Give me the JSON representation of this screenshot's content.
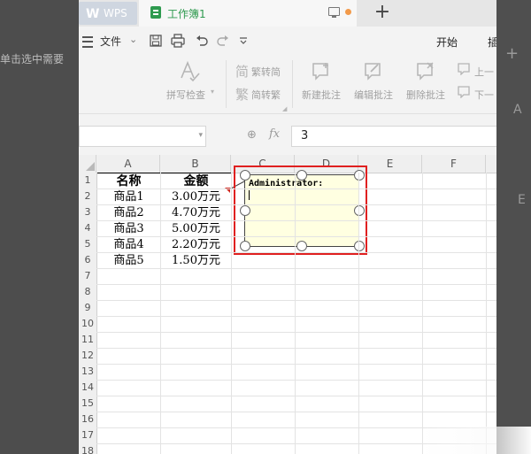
{
  "background": {
    "left_fragment": "单击选中需要",
    "right_plus": "+",
    "right_a": "A",
    "right_e": "E"
  },
  "tabs": {
    "wps_label": "WPS",
    "doc_label": "工作簿1",
    "new_tab": "+"
  },
  "menubar": {
    "file_label": "文件",
    "file_arrow": "⌄",
    "start_tab": "开始",
    "insert_tab": "插"
  },
  "ribbon": {
    "spellcheck": "拼写检查",
    "trad_to_simp": "繁转简",
    "simp_to_trad": "简转繁",
    "new_comment": "新建批注",
    "edit_comment": "编辑批注",
    "delete_comment": "删除批注",
    "prev": "上一",
    "next": "下一"
  },
  "formula_bar": {
    "name_box": "",
    "formula_value": "3"
  },
  "sheet": {
    "columns": [
      "A",
      "B",
      "C",
      "D",
      "E",
      "F"
    ],
    "rows": [
      "1",
      "2",
      "3",
      "4",
      "5",
      "6",
      "7",
      "8",
      "9",
      "10",
      "11",
      "12",
      "13",
      "14",
      "15",
      "16",
      "17",
      "18"
    ],
    "header": [
      "名称",
      "金额"
    ],
    "data": [
      [
        "商品1",
        "3.00万元"
      ],
      [
        "商品2",
        "4.70万元"
      ],
      [
        "商品3",
        "5.00万元"
      ],
      [
        "商品4",
        "2.20万元"
      ],
      [
        "商品5",
        "1.50万元"
      ]
    ]
  },
  "comment": {
    "author": "Administrator:",
    "text": ""
  },
  "colors": {
    "accent_green": "#2e9a4f",
    "highlight_red": "#e02020",
    "comment_bg": "#ffffe1"
  }
}
